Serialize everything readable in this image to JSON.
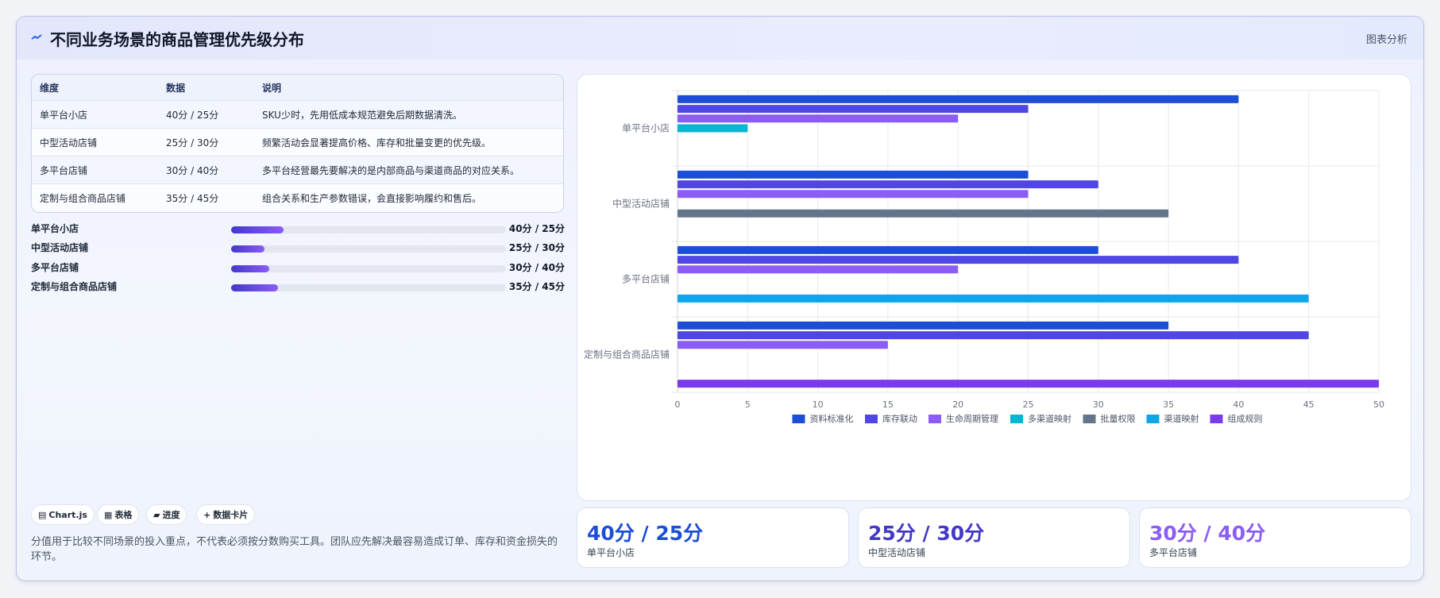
{
  "header": {
    "title": "不同业务场景的商品管理优先级分布",
    "link": "图表分析"
  },
  "table": {
    "columns": [
      "维度",
      "数据",
      "说明"
    ],
    "rows": [
      [
        "单平台小店",
        "40分 / 25分",
        "SKU少时，先用低成本规范避免后期数据清洗。"
      ],
      [
        "中型活动店铺",
        "25分 / 30分",
        "频繁活动会显著提高价格、库存和批量变更的优先级。"
      ],
      [
        "多平台店铺",
        "30分 / 40分",
        "多平台经营最先要解决的是内部商品与渠道商品的对应关系。"
      ],
      [
        "定制与组合商品店铺",
        "35分 / 45分",
        "组合关系和生产参数错误，会直接影响履约和售后。"
      ]
    ]
  },
  "progress": [
    {
      "label": "单平台小店",
      "value": "40分 / 25分",
      "fraction": 0.19
    },
    {
      "label": "中型活动店铺",
      "value": "25分 / 30分",
      "fraction": 0.12
    },
    {
      "label": "多平台店铺",
      "value": "30分 / 40分",
      "fraction": 0.14
    },
    {
      "label": "定制与组合商品店铺",
      "value": "35分 / 45分",
      "fraction": 0.17
    }
  ],
  "chips": [
    "Chart.js",
    "表格",
    "进度",
    "数据卡片"
  ],
  "note": "分值用于比较不同场景的投入重点，不代表必须按分数购买工具。团队应先解决最容易造成订单、库存和资金损失的环节。",
  "stats": [
    {
      "value": "40分 / 25分",
      "label": "单平台小店",
      "color": "#1d4ed8"
    },
    {
      "value": "25分 / 30分",
      "label": "中型活动店铺",
      "color": "#4338ca"
    },
    {
      "value": "30分 / 40分",
      "label": "多平台店铺",
      "color": "#8b5cf6"
    }
  ],
  "chart_data": {
    "type": "bar",
    "orientation": "horizontal",
    "categories": [
      "单平台小店",
      "中型活动店铺",
      "多平台店铺",
      "定制与组合商品店铺"
    ],
    "series": [
      {
        "name": "资料标准化",
        "color": "#1d4ed8",
        "values": [
          40,
          25,
          30,
          35
        ]
      },
      {
        "name": "库存联动",
        "color": "#4f46e5",
        "values": [
          25,
          30,
          40,
          45
        ]
      },
      {
        "name": "生命周期管理",
        "color": "#8b5cf6",
        "values": [
          20,
          25,
          20,
          15
        ]
      },
      {
        "name": "多渠道映射",
        "color": "#06b6d4",
        "values": [
          5,
          0,
          0,
          0
        ]
      },
      {
        "name": "批量权限",
        "color": "#64748b",
        "values": [
          0,
          35,
          0,
          0
        ]
      },
      {
        "name": "渠道映射",
        "color": "#0ea5e9",
        "values": [
          0,
          0,
          45,
          0
        ]
      },
      {
        "name": "组成规则",
        "color": "#7c3aed",
        "values": [
          0,
          0,
          0,
          50
        ]
      }
    ],
    "xlim": [
      0,
      50
    ],
    "xticks": [
      "0",
      "5",
      "10",
      "15",
      "20",
      "25",
      "30",
      "35",
      "40",
      "45",
      "50"
    ],
    "grid": true,
    "legend": "bottom"
  }
}
